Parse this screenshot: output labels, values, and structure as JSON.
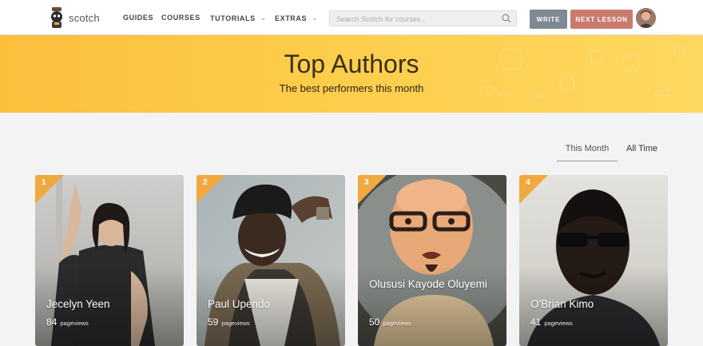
{
  "nav": {
    "logo_text": "scotch",
    "links": [
      {
        "label": "GUIDES",
        "has_dropdown": false
      },
      {
        "label": "COURSES",
        "has_dropdown": false
      },
      {
        "label": "TUTORIALS",
        "has_dropdown": true
      },
      {
        "label": "EXTRAS",
        "has_dropdown": true
      }
    ],
    "dropdown_glyph": "⌄",
    "search_placeholder": "Search Scotch for courses...",
    "write_label": "WRITE",
    "next_lesson_label": "NEXT LESSON"
  },
  "hero": {
    "title": "Top Authors",
    "subtitle": "The best performers this month"
  },
  "tabs": {
    "this_month": "This Month",
    "all_time": "All Time",
    "active": "This Month"
  },
  "authors": [
    {
      "rank": "1",
      "name": "Jecelyn Yeen",
      "views": "84",
      "views_label": "pageviews"
    },
    {
      "rank": "2",
      "name": "Paul Upendo",
      "views": "59",
      "views_label": "pageviews"
    },
    {
      "rank": "3",
      "name": "Olususi Kayode Oluyemi",
      "views": "50",
      "views_label": "pageviews"
    },
    {
      "rank": "4",
      "name": "O'Brian Kimo",
      "views": "41",
      "views_label": "pageviews"
    }
  ],
  "colors": {
    "hero_yellow": "#fdcd4a",
    "rank_badge": "#f0a940",
    "write_button": "#7d8a94",
    "next_button": "#c97b70"
  }
}
